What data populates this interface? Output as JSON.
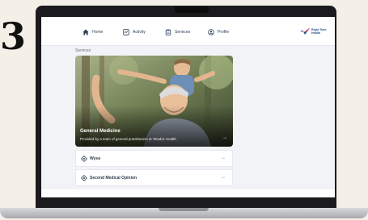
{
  "step": {
    "number": "3"
  },
  "nav": {
    "items": [
      {
        "label": "Home",
        "icon": "home-icon"
      },
      {
        "label": "Activity",
        "icon": "activity-icon"
      },
      {
        "label": "Services",
        "icon": "services-icon"
      },
      {
        "label": "Profile",
        "icon": "profile-icon"
      }
    ]
  },
  "logo": {
    "line1": "Right Time",
    "line2": "Health"
  },
  "main": {
    "section_title": "Services",
    "hero": {
      "title": "General Medicine",
      "subtitle": "Provided by a team of general practitioners at Teladoc Health",
      "arrow": "→"
    },
    "list": [
      {
        "label": "Wysa",
        "arrow": "→",
        "icon": "service-icon"
      },
      {
        "label": "Second Medical Opinion",
        "arrow": "→",
        "icon": "service-icon"
      }
    ]
  },
  "colors": {
    "accent": "#1e8fc7",
    "nav_text": "#2c3e57",
    "background": "#f1f3f7"
  }
}
